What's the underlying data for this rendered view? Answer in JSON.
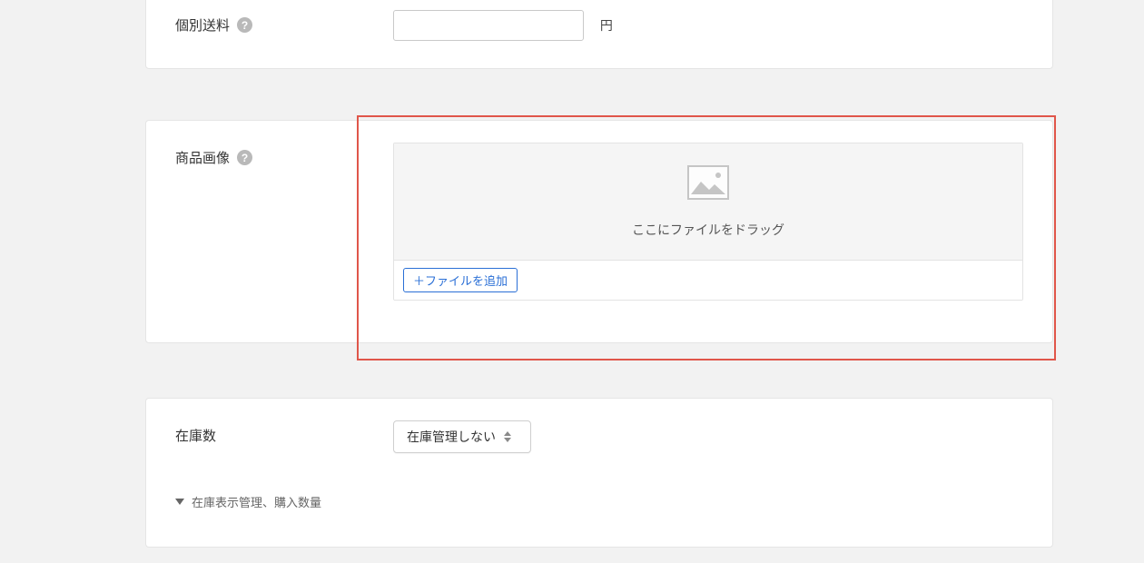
{
  "shipping": {
    "label": "個別送料",
    "value": "",
    "unit": "円"
  },
  "image_section": {
    "label": "商品画像",
    "drop_text": "ここにファイルをドラッグ",
    "add_file_label": "＋ファイルを追加"
  },
  "stock": {
    "label": "在庫数",
    "selected": "在庫管理しない",
    "collapse_label": "在庫表示管理、購入数量"
  }
}
